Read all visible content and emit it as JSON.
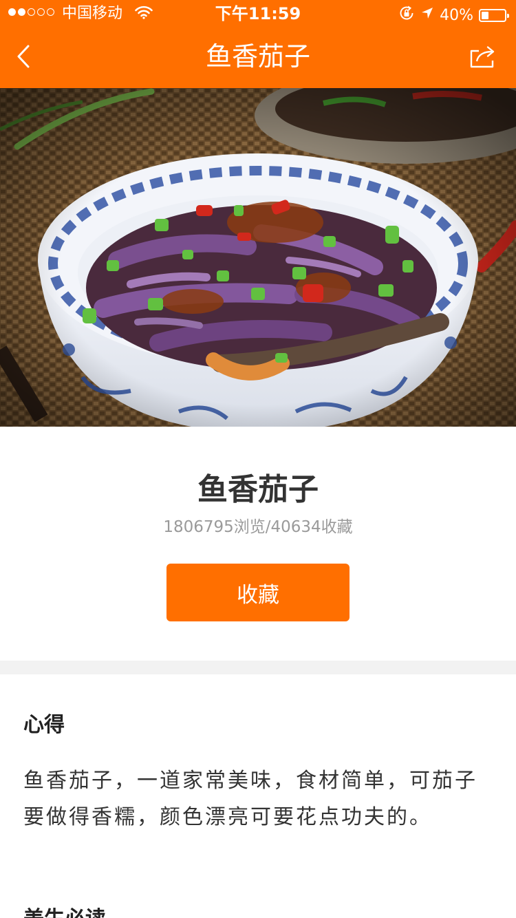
{
  "status_bar": {
    "carrier": "中国移动",
    "time": "下午11:59",
    "battery": "40%",
    "battery_level": 0.4
  },
  "nav": {
    "title": "鱼香茄子",
    "back_icon": "chevron-left-icon",
    "share_icon": "share-icon"
  },
  "recipe": {
    "title": "鱼香茄子",
    "stats": "1806795浏览/40634收藏",
    "favorite_label": "收藏"
  },
  "tips": {
    "heading": "心得",
    "text": "鱼香茄子，一道家常美味，食材简单，可茄子要做得香糯，颜色漂亮可要花点功夫的。",
    "next_heading": "美生必读"
  },
  "colors": {
    "accent": "#ff6f00",
    "divider": "#f2f2f2",
    "secondary_text": "#9a9a9a"
  }
}
